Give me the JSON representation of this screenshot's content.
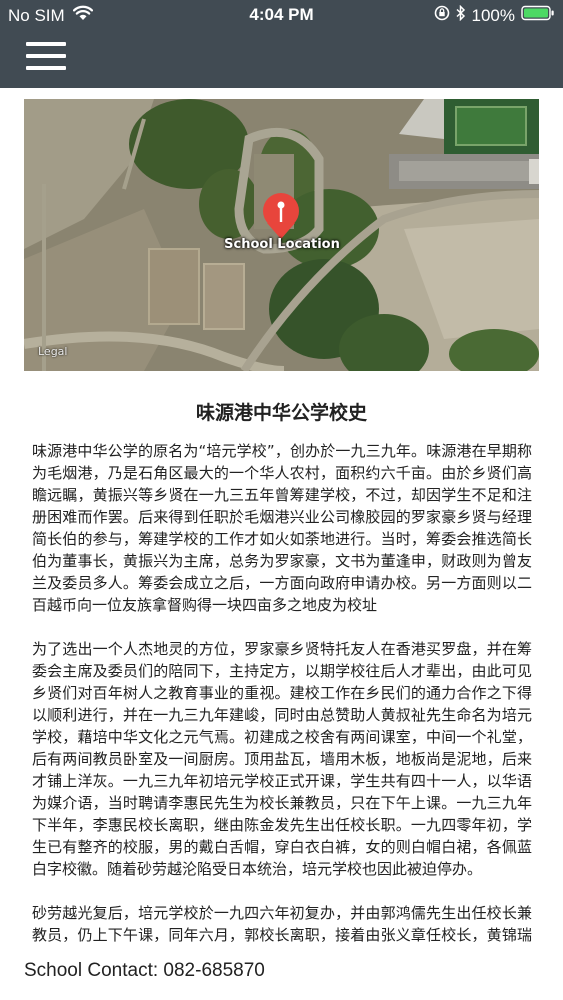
{
  "status_bar": {
    "carrier": "No SIM",
    "time": "4:04 PM",
    "battery": "100%",
    "icons": [
      "wifi-icon",
      "orientation-lock-icon",
      "bluetooth-icon",
      "battery-icon"
    ]
  },
  "navbar": {
    "menu_icon": "hamburger-icon"
  },
  "map": {
    "pin_label": "School Location",
    "legal": "Legal",
    "pin_color": "#e8453c"
  },
  "article": {
    "title": "味源港中华公学校史",
    "paragraphs": [
      "味源港中华公学的原名为“培元学校”，创办於一九三九年。味源港在早期称为毛烟港，乃是石角区最大的一个华人农村，面积约六千亩。由於乡贤们高瞻远瞩，黄振兴等乡贤在一九三五年曾筹建学校，不过，却因学生不足和注册困难而作罢。后来得到任职於毛烟港兴业公司橡胶园的罗家豪乡贤与经理简长伯的参与，筹建学校的工作才如火如荼地进行。当时，筹委会推选简长伯为董事长，黄振兴为主席，总务为罗家豪，文书为董逢申，财政则为曾友兰及委员多人。筹委会成立之后，一方面向政府申请办校。另一方面则以二百越币向一位友族拿督购得一块四亩多之地皮为校址",
      "为了选出一个人杰地灵的方位，罗家豪乡贤特托友人在香港买罗盘，并在筹委会主席及委员们的陪同下，主持定方，以期学校往后人才辈出，由此可见乡贤们对百年树人之教育事业的重视。建校工作在乡民们的通力合作之下得以顺利进行，并在一九三九年建峻，同时由总赞助人黄叔祉先生命名为培元学校，藉培中华文化之元气焉。初建成之校舍有两间课室，中间一个礼堂，后有两间教员卧室及一间厨房。顶用盐瓦，墙用木板，地板尚是泥地，后来才铺上洋灰。一九三九年初培元学校正式开课，学生共有四十一人，以华语为媒介语，当时聘请李惠民先生为校长兼教员，只在下午上课。一九三九年下半年，李惠民校长离职，继由陈金发先生出任校长职。一九四零年初，学生已有整齐的校服，男的戴白舌帽，穿白衣白裤，女的则白帽白裙，各佩蓝白字校徽。随着砂劳越沦陷受日本统治，培元学校也因此被迫停办。",
      "砂劳越光复后，培元学校於一九四六年初复办，并由郭鸿儒先生出任校长兼教员，仍上下午课，同年六月，郭校长离职，接着由张义章任校长，黄锦瑞为教员，均执教一年。当年曾组织学生、校友游艺团到"
    ]
  },
  "footer": {
    "contact": "School Contact: 082-685870"
  }
}
